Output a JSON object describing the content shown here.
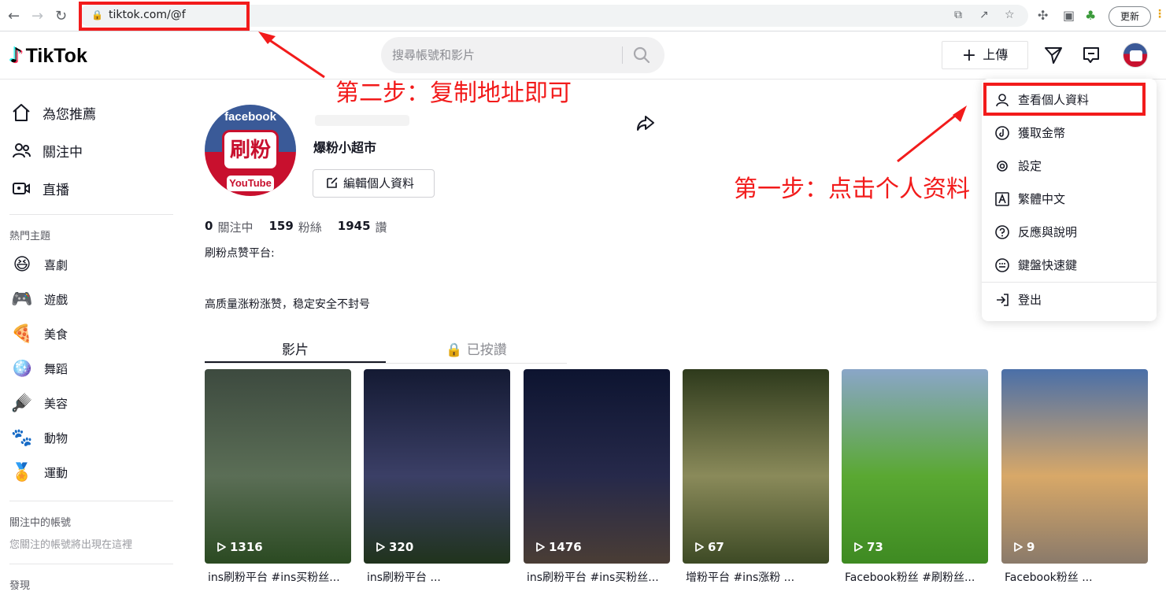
{
  "browser": {
    "url": "tiktok.com/@f",
    "update_label": "更新"
  },
  "header": {
    "logo_text": "TikTok",
    "search_placeholder": "搜尋帳號和影片",
    "upload_label": "上傳"
  },
  "sidebar": {
    "nav": [
      {
        "label": "為您推薦",
        "icon": "home-icon"
      },
      {
        "label": "關注中",
        "icon": "following-icon"
      },
      {
        "label": "直播",
        "icon": "live-icon"
      }
    ],
    "topics_heading": "熱門主題",
    "topics": [
      {
        "label": "喜劇",
        "icon": "comedy-icon"
      },
      {
        "label": "遊戲",
        "icon": "gaming-icon"
      },
      {
        "label": "美食",
        "icon": "food-icon"
      },
      {
        "label": "舞蹈",
        "icon": "dance-icon"
      },
      {
        "label": "美容",
        "icon": "beauty-icon"
      },
      {
        "label": "動物",
        "icon": "animals-icon"
      },
      {
        "label": "運動",
        "icon": "sports-icon"
      }
    ],
    "following_heading": "關注中的帳號",
    "following_note": "您關注的帳號將出現在這裡",
    "discover_heading": "發現"
  },
  "profile": {
    "nickname": "爆粉小超市",
    "edit_label": "編輯個人資料",
    "avatar_fb": "facebook",
    "avatar_badge": "刷粉",
    "avatar_yt": "YouTube",
    "following_count": "0",
    "following_label": "關注中",
    "followers_count": "159",
    "followers_label": "粉絲",
    "likes_count": "1945",
    "likes_label": "讚",
    "bio_line1": "刷粉点赞平台:",
    "bio_line2": "高质量涨粉涨赞，稳定安全不封号"
  },
  "tabs": {
    "videos": "影片",
    "liked": "已按讚"
  },
  "videos": [
    {
      "views": "1316",
      "caption": "ins刷粉平台 #ins买粉丝...",
      "colors": [
        "#3d4a3f",
        "#5b6e56",
        "#2b4a22"
      ]
    },
    {
      "views": "320",
      "caption": "ins刷粉平台 ...",
      "colors": [
        "#141a33",
        "#3b3f66",
        "#20331c"
      ]
    },
    {
      "views": "1476",
      "caption": "ins刷粉平台 #ins买粉丝...",
      "colors": [
        "#0d1430",
        "#26294a",
        "#4a3d35"
      ]
    },
    {
      "views": "67",
      "caption": "增粉平台 #ins涨粉 ...",
      "colors": [
        "#2e3a1c",
        "#8a8a5a",
        "#3d4a25"
      ]
    },
    {
      "views": "73",
      "caption": "Facebook粉丝 #刷粉丝...",
      "colors": [
        "#8aa6c8",
        "#5aa832",
        "#3e8a22"
      ]
    },
    {
      "views": "9",
      "caption": "Facebook粉丝 ...",
      "colors": [
        "#4a6fa8",
        "#d8a868",
        "#8a7a6a"
      ]
    }
  ],
  "menu": {
    "items": [
      {
        "label": "查看個人資料",
        "icon": "user-icon"
      },
      {
        "label": "獲取金幣",
        "icon": "coin-icon"
      },
      {
        "label": "設定",
        "icon": "settings-icon"
      },
      {
        "label": "繁體中文",
        "icon": "language-icon"
      },
      {
        "label": "反應與說明",
        "icon": "help-icon"
      },
      {
        "label": "鍵盤快速鍵",
        "icon": "keyboard-icon"
      },
      {
        "label": "登出",
        "icon": "logout-icon"
      }
    ]
  },
  "annotations": {
    "step1": "第一步：点击个人资料",
    "step2": "第二步：复制地址即可"
  },
  "colors": {
    "annotation_red": "#f21b1b",
    "tiktok_cyan": "#25f4ee",
    "tiktok_pink": "#fe2c55"
  }
}
